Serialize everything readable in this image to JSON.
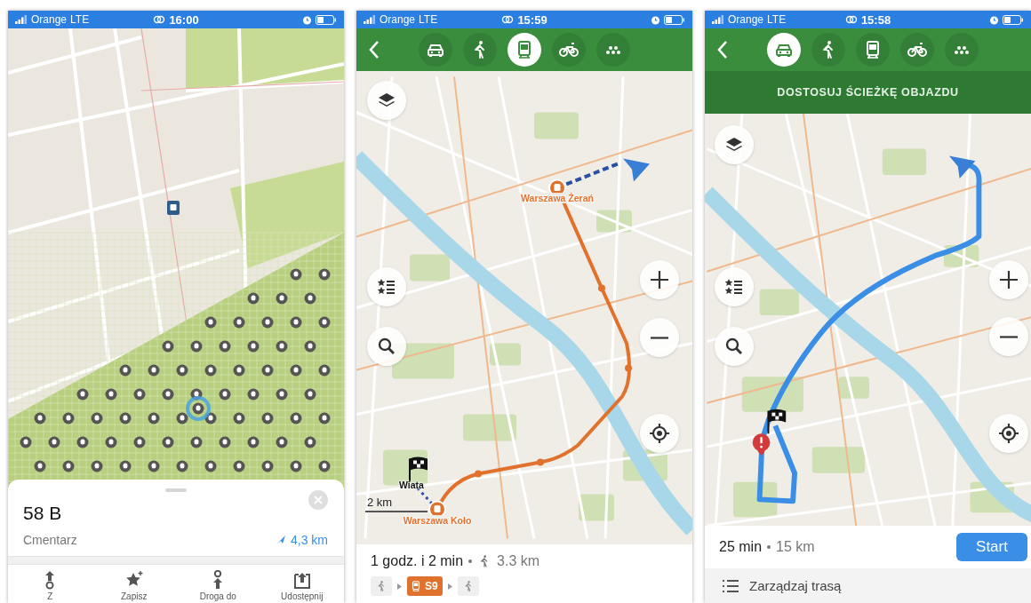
{
  "screens": [
    {
      "kind": "place",
      "status_bar": {
        "carrier": "Orange",
        "network": "LTE",
        "time": "16:00"
      },
      "place_card": {
        "title": "58 B",
        "subtitle": "Cmentarz",
        "distance": "4,3 km",
        "actions": [
          {
            "label": "Z"
          },
          {
            "label": "Zapisz"
          },
          {
            "label": "Droga do"
          },
          {
            "label": "Udostępnij"
          }
        ]
      }
    },
    {
      "kind": "transit",
      "status_bar": {
        "carrier": "Orange",
        "network": "LTE",
        "time": "15:59"
      },
      "modes": [
        {
          "selected": false
        },
        {
          "selected": false
        },
        {
          "selected": true
        },
        {
          "selected": false
        },
        {
          "selected": false
        }
      ],
      "map": {
        "stops": [
          {
            "label": "Warszawa Żerań"
          },
          {
            "label": "Wiata"
          },
          {
            "label": "Warszawa Koło"
          }
        ],
        "scale": "2 km"
      },
      "summary": {
        "duration": "1 godz. i 2 min",
        "walk_distance": "3.3 km",
        "steps": [
          {
            "kind": "walk"
          },
          {
            "kind": "train",
            "label": "S9"
          },
          {
            "kind": "walk"
          }
        ]
      }
    },
    {
      "kind": "drive",
      "status_bar": {
        "carrier": "Orange",
        "network": "LTE",
        "time": "15:58"
      },
      "modes": [
        {
          "selected": true
        },
        {
          "selected": false
        },
        {
          "selected": false
        },
        {
          "selected": false
        },
        {
          "selected": false
        }
      ],
      "banner": "DOSTOSUJ ŚCIEŻKĘ OBJAZDU",
      "summary": {
        "duration": "25 min",
        "distance": "15 km",
        "start_button": "Start",
        "manage": "Zarządzaj trasą"
      }
    }
  ]
}
